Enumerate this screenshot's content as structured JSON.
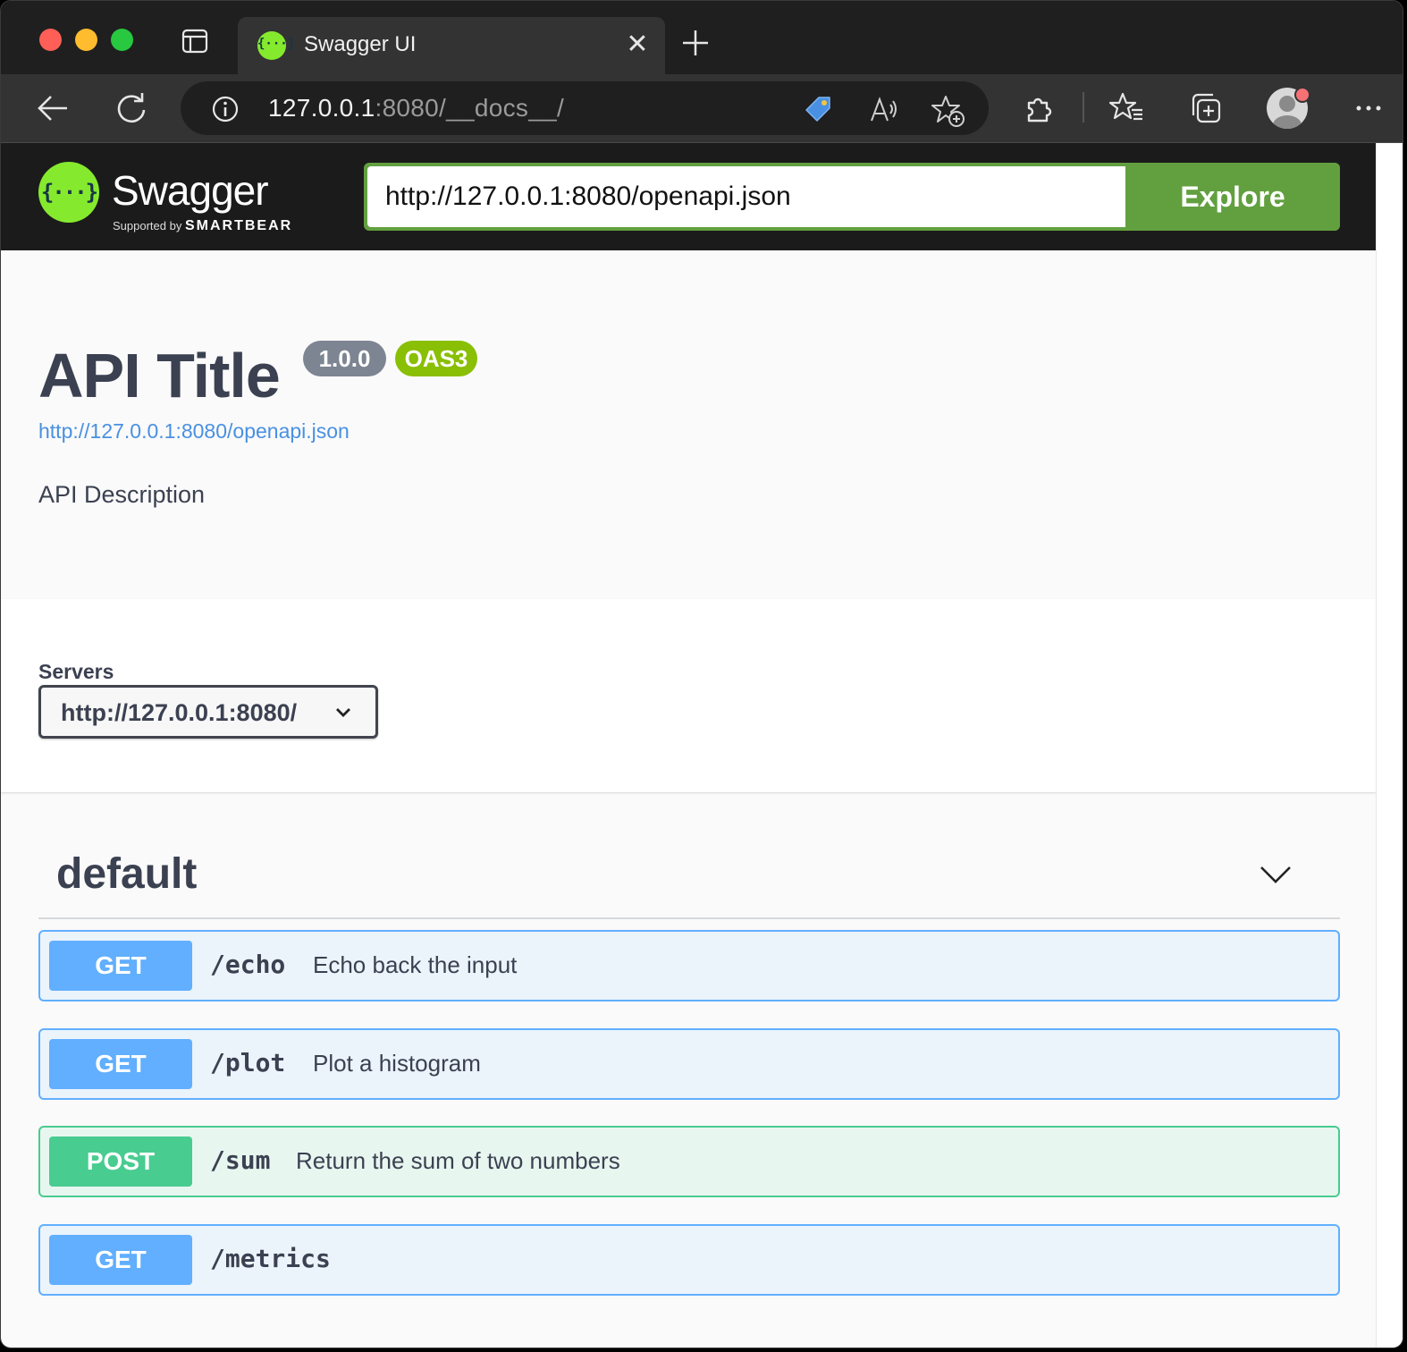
{
  "browser": {
    "tab": {
      "title": "Swagger UI",
      "close_glyph": "✕"
    },
    "address": {
      "host": "127.0.0.1",
      "rest": ":8080/__docs__/"
    }
  },
  "swagger": {
    "brand": "Swagger",
    "supported_by": "Supported by",
    "smartbear": "SMARTBEAR",
    "logo_glyph": "{···}",
    "explore_url": "http://127.0.0.1:8080/openapi.json",
    "explore_label": "Explore"
  },
  "info": {
    "title": "API Title",
    "version": "1.0.0",
    "oas": "OAS3",
    "spec_link": "http://127.0.0.1:8080/openapi.json",
    "description": "API Description"
  },
  "servers": {
    "label": "Servers",
    "selected": "http://127.0.0.1:8080/"
  },
  "tag": {
    "name": "default",
    "operations": [
      {
        "method": "GET",
        "path": "/echo",
        "summary": "Echo back the input"
      },
      {
        "method": "GET",
        "path": "/plot",
        "summary": "Plot a histogram"
      },
      {
        "method": "POST",
        "path": "/sum",
        "summary": "Return the sum of two numbers"
      },
      {
        "method": "GET",
        "path": "/metrics",
        "summary": ""
      }
    ]
  },
  "colors": {
    "get": "#61affe",
    "post": "#49cc90",
    "swagger_green": "#85ea2d",
    "explore_green": "#62a03f"
  }
}
